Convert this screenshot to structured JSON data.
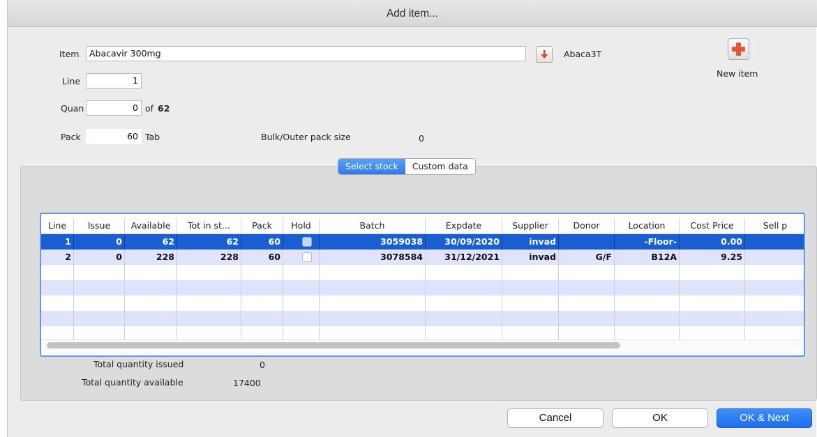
{
  "window": {
    "title": "Add item..."
  },
  "form": {
    "item_label": "Item",
    "item_value": "Abacavir 300mg",
    "item_code": "Abaca3T",
    "line_label": "Line",
    "line_value": "1",
    "quan_label": "Quan",
    "quan_value": "0",
    "quan_of": "of",
    "quan_total": "62",
    "pack_label": "Pack",
    "pack_value": "60",
    "pack_unit": "Tab",
    "bulk_label": "Bulk/Outer pack size",
    "bulk_value": "0",
    "new_item_label": "New item"
  },
  "tabs": [
    {
      "label": "Select stock",
      "active": true
    },
    {
      "label": "Custom data",
      "active": false
    }
  ],
  "table": {
    "columns": [
      "Line",
      "Issue",
      "Available",
      "Tot in st...",
      "Pack",
      "Hold",
      "Batch",
      "Expdate",
      "Supplier",
      "Donor",
      "Location",
      "Cost Price",
      "Sell p"
    ],
    "rows": [
      {
        "line": "1",
        "issue": "0",
        "available": "62",
        "tot": "62",
        "pack": "60",
        "hold": true,
        "batch": "3059038",
        "expdate": "30/09/2020",
        "supplier": "invad",
        "donor": "",
        "location": "-Floor-",
        "cost": "0.00",
        "sell": ""
      },
      {
        "line": "2",
        "issue": "0",
        "available": "228",
        "tot": "228",
        "pack": "60",
        "hold": false,
        "batch": "3078584",
        "expdate": "31/12/2021",
        "supplier": "invad",
        "donor": "G/F",
        "location": "B12A",
        "cost": "9.25",
        "sell": ""
      }
    ]
  },
  "totals": {
    "issued_label": "Total quantity issued",
    "issued_value": "0",
    "available_label": "Total quantity available",
    "available_value": "17400"
  },
  "buttons": {
    "cancel": "Cancel",
    "ok": "OK",
    "ok_next": "OK & Next"
  },
  "colors": {
    "accent": "#1c6ff0",
    "selection": "#1a5fd1",
    "alt_row": "#dfe3fb",
    "new_item_icon": "#e8563a"
  },
  "icons": {
    "download": "download-arrow-icon",
    "new_item": "plus-icon"
  }
}
